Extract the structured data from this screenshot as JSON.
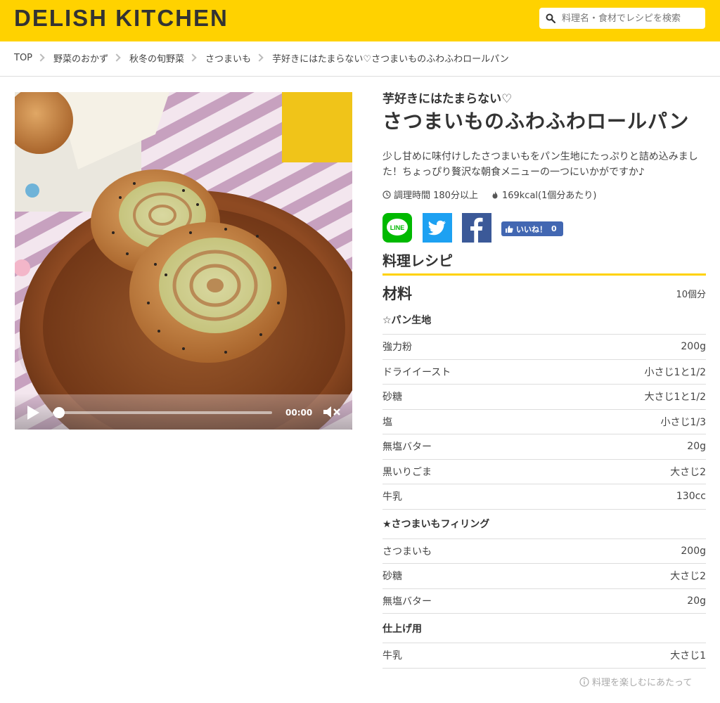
{
  "header": {
    "logo": "DELISH KITCHEN",
    "search_placeholder": "料理名・食材でレシピを検索",
    "brand_color": "#FFD200"
  },
  "breadcrumb": [
    "TOP",
    "野菜のおかず",
    "秋冬の旬野菜",
    "さつまいも",
    "芋好きにはたまらない♡さつまいものふわふわロールパン"
  ],
  "video": {
    "time": "00:00",
    "progress": 0.03,
    "icons": [
      "play-icon",
      "mute-icon"
    ]
  },
  "recipe": {
    "subtitle": "芋好きにはたまらない♡",
    "title": "さつまいものふわふわロールパン",
    "description": "少し甘めに味付けしたさつまいもをパン生地にたっぷりと詰め込みました！ちょっぴり贅沢な朝食メニューの一つにいかがですか♪",
    "cook_time": "調理時間 180分以上",
    "calories": "169kcal(1個分あたり)"
  },
  "share": {
    "line_label": "LINE",
    "like_label": "いいね！",
    "like_count": "0",
    "line_color": "#00B900",
    "twitter_color": "#1DA1F2",
    "facebook_color": "#3B5998"
  },
  "section_title": "料理レシピ",
  "ingredients": {
    "title": "材料",
    "serving": "10個分",
    "groups": [
      {
        "name": "☆パン生地",
        "items": [
          {
            "name": "強力粉",
            "amount": "200g"
          },
          {
            "name": "ドライイースト",
            "amount": "小さじ1と1/2"
          },
          {
            "name": "砂糖",
            "amount": "大さじ1と1/2"
          },
          {
            "name": "塩",
            "amount": "小さじ1/3"
          },
          {
            "name": "無塩バター",
            "amount": "20g"
          },
          {
            "name": "黒いりごま",
            "amount": "大さじ2"
          },
          {
            "name": "牛乳",
            "amount": "130cc"
          }
        ]
      },
      {
        "name": "★さつまいもフィリング",
        "items": [
          {
            "name": "さつまいも",
            "amount": "200g"
          },
          {
            "name": "砂糖",
            "amount": "大さじ2"
          },
          {
            "name": "無塩バター",
            "amount": "20g"
          }
        ]
      },
      {
        "name": "仕上げ用",
        "items": [
          {
            "name": "牛乳",
            "amount": "大さじ1"
          }
        ]
      }
    ]
  },
  "notice": "料理を楽しむにあたって"
}
